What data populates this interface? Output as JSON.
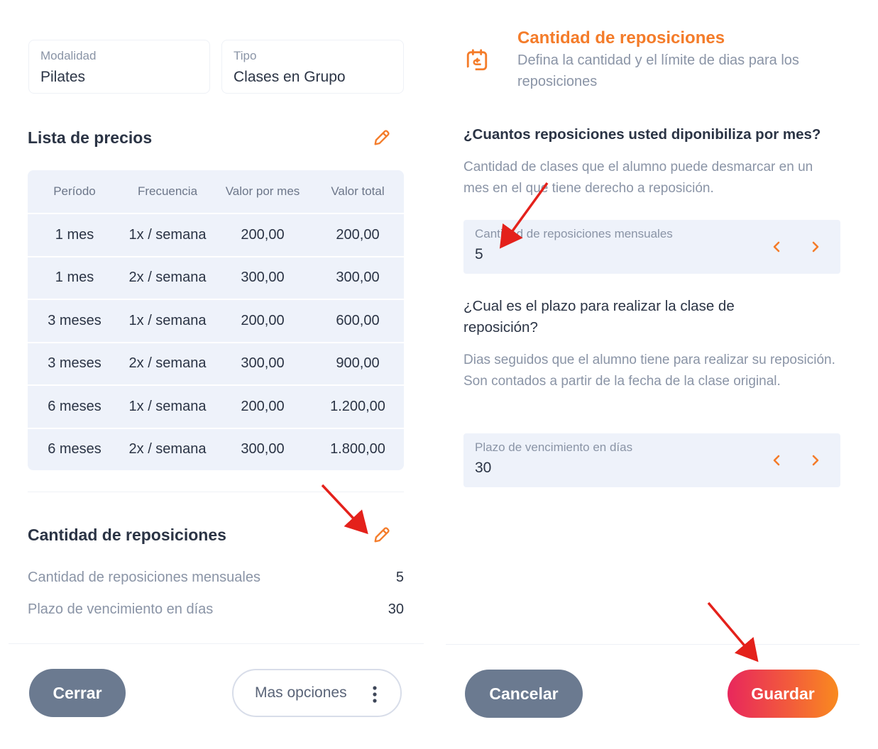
{
  "left": {
    "modalidad": {
      "label": "Modalidad",
      "value": "Pilates"
    },
    "tipo": {
      "label": "Tipo",
      "value": "Clases en Grupo"
    },
    "price_list": {
      "title": "Lista de precios",
      "columns": [
        "Período",
        "Frecuencia",
        "Valor por mes",
        "Valor total"
      ],
      "rows": [
        [
          "1 mes",
          "1x / semana",
          "200,00",
          "200,00"
        ],
        [
          "1 mes",
          "2x / semana",
          "300,00",
          "300,00"
        ],
        [
          "3 meses",
          "1x / semana",
          "200,00",
          "600,00"
        ],
        [
          "3 meses",
          "2x / semana",
          "300,00",
          "900,00"
        ],
        [
          "6 meses",
          "1x / semana",
          "200,00",
          "1.200,00"
        ],
        [
          "6 meses",
          "2x / semana",
          "300,00",
          "1.800,00"
        ]
      ]
    },
    "reposiciones": {
      "title": "Cantidad de reposiciones",
      "items": [
        {
          "label": "Cantidad de reposiciones  mensuales",
          "value": "5"
        },
        {
          "label": "Plazo de vencimiento en días",
          "value": "30"
        }
      ]
    },
    "buttons": {
      "close": "Cerrar",
      "more": "Mas opciones"
    }
  },
  "right": {
    "title": "Cantidad de reposiciones",
    "subtitle": "Defina la cantidad y el límite de dias para los reposiciones",
    "q1": "¿Cuantos reposiciones usted diponibiliza por mes?",
    "d1": "Cantidad de clases que el alumno puede desmarcar en un mes en el que tiene derecho a reposición.",
    "field1": {
      "label": "Cantidad de reposiciones  mensuales",
      "value": "5"
    },
    "q2": "¿Cual es el plazo para realizar la clase de reposición?",
    "d2": "Dias seguidos que el alumno tiene para realizar su reposición. Son contados a partir de la fecha de la clase original.",
    "field2": {
      "label": "Plazo de vencimiento en días",
      "value": "30"
    },
    "buttons": {
      "cancel": "Cancelar",
      "save": "Guardar"
    }
  },
  "colors": {
    "accent": "#f47c2a",
    "text": "#2b3445",
    "muted": "#8a94a6",
    "panel": "#eef2fa",
    "arrow": "#e4211b"
  },
  "icons": [
    "pencil-icon",
    "calendar-refresh-icon",
    "chevron-left-icon",
    "chevron-right-icon",
    "kebab-menu-icon"
  ]
}
